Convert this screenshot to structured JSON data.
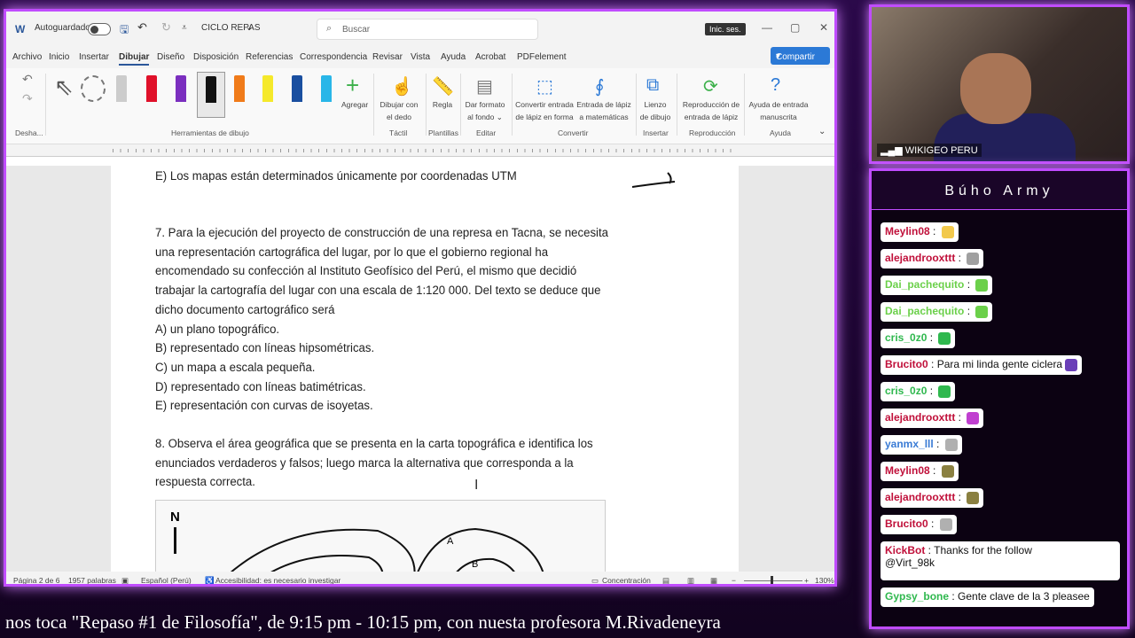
{
  "window": {
    "autosave_label": "Autoguardado",
    "doc_title": "CICLO REPAS",
    "search_placeholder": "Buscar",
    "signin": "Inic. ses.",
    "min": "—",
    "max": "▢",
    "close": "✕"
  },
  "menu": [
    "Archivo",
    "Inicio",
    "Insertar",
    "Dibujar",
    "Diseño",
    "Disposición",
    "Referencias",
    "Correspondencia",
    "Revisar",
    "Vista",
    "Ayuda",
    "Acrobat",
    "PDFelement"
  ],
  "share_label": "Compartir",
  "ribbon": {
    "undo_group": "Desha...",
    "drawing_tools_group": "Herramientas de dibujo",
    "add_label": "Agregar",
    "buttons": [
      {
        "label1": "Dibujar con",
        "label2": "el dedo"
      },
      {
        "label1": "Regla",
        "label2": ""
      },
      {
        "label1": "Dar formato",
        "label2": "al fondo"
      },
      {
        "label1": "Convertir entrada",
        "label2": "de lápiz en forma"
      },
      {
        "label1": "Entrada de lápiz",
        "label2": "a matemáticas"
      },
      {
        "label1": "Lienzo",
        "label2": "de dibujo"
      },
      {
        "label1": "Reproducción de",
        "label2": "entrada de lápiz"
      },
      {
        "label1": "Ayuda de entrada",
        "label2": "manuscrita"
      }
    ],
    "groups": [
      "Táctil",
      "Plantillas",
      "Editar",
      "Convertir",
      "Insertar",
      "Reproducción",
      "Ayuda"
    ]
  },
  "document": {
    "line_e_prev": "E) Los mapas están determinados únicamente por coordenadas UTM",
    "q7": [
      "7. Para la ejecución del proyecto de construcción de una represa en Tacna, se necesita",
      "una representación cartográfica del lugar, por lo que el gobierno regional ha",
      "encomendado su confección al Instituto Geofísico del Perú, el mismo que decidió",
      "trabajar la cartografía del lugar con una escala de 1:120 000. Del texto se deduce que",
      "dicho documento cartográfico será",
      "A) un plano topográfico.",
      "B) representado con líneas hipsométricas.",
      "C) un mapa a escala pequeña.",
      "D) representado con líneas batimétricas.",
      "E) representación con curvas de isoyetas."
    ],
    "q8": [
      "8. Observa el área geográfica que se presenta en la carta topográfica e identifica los",
      "enunciados verdaderos y falsos; luego marca la alternativa que corresponda a la",
      "respuesta correcta."
    ],
    "map_north": "N",
    "map_a": "A",
    "map_b": "B"
  },
  "status": {
    "page": "Página 2 de 6",
    "words": "1957 palabras",
    "lang": "Español (Perú)",
    "access": "Accesibilidad: es necesario investigar",
    "focus": "Concentración",
    "zoom": "130%"
  },
  "camera": {
    "name": "WIKIGEO PERU"
  },
  "chat": {
    "title": "Búho Army",
    "messages": [
      {
        "user": "Meylin08",
        "text": "",
        "color": "#c0103a"
      },
      {
        "user": "alejandrooxttt",
        "text": "",
        "color": "#c0103a"
      },
      {
        "user": "Dai_pachequito",
        "text": "",
        "color": "#6bd04a"
      },
      {
        "user": "Dai_pachequito",
        "text": "",
        "color": "#6bd04a"
      },
      {
        "user": "cris_0z0",
        "text": "",
        "color": "#2fb84e"
      },
      {
        "user": "Brucito0",
        "text": "Para mi linda gente ciclera",
        "color": "#c0103a"
      },
      {
        "user": "cris_0z0",
        "text": "",
        "color": "#2fb84e"
      },
      {
        "user": "alejandrooxttt",
        "text": "",
        "color": "#c0103a"
      },
      {
        "user": "yanmx_lll",
        "text": "",
        "color": "#3a7bd5"
      },
      {
        "user": "Meylin08",
        "text": "",
        "color": "#c0103a"
      },
      {
        "user": "alejandrooxttt",
        "text": "",
        "color": "#c0103a"
      },
      {
        "user": "Brucito0",
        "text": "",
        "color": "#c0103a"
      },
      {
        "user": "KickBot",
        "text": "Thanks for the follow",
        "color": "#c0103a"
      },
      {
        "user": "Gypsy_bone",
        "text": "Gente clave de la 3 pleasee",
        "color": "#2fb84e"
      }
    ],
    "kickbot_mention": "@Virt_98k"
  },
  "ticker": "nos toca \"Repaso #1 de Filosofía\", de 9:15 pm - 10:15 pm, con nuesta profesora M.Rivadeneyra"
}
